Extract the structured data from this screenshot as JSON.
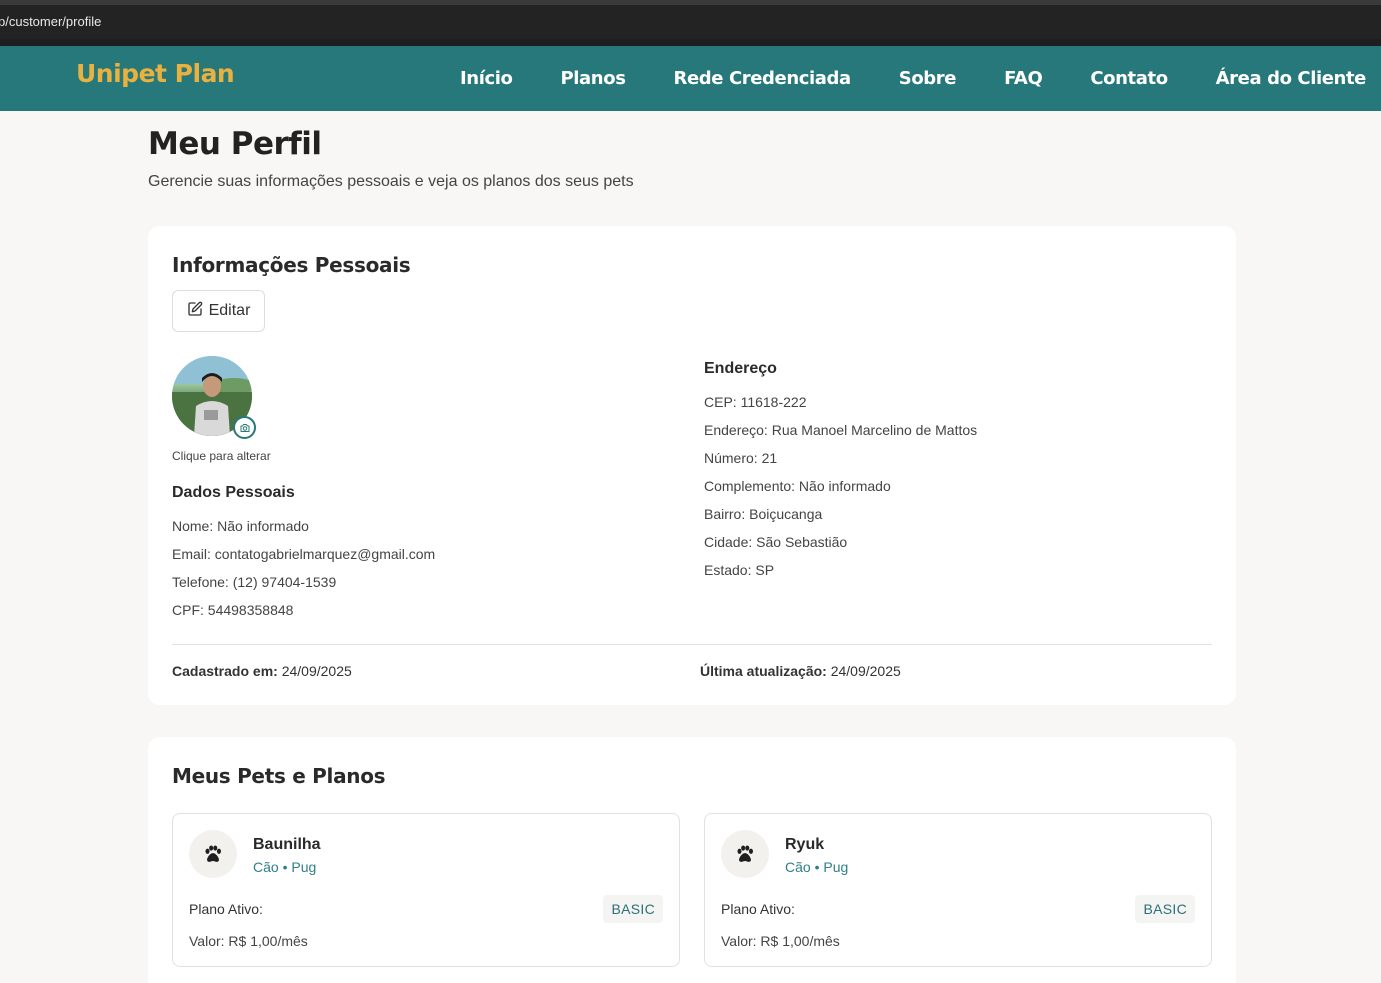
{
  "browser": {
    "url": "p/customer/profile"
  },
  "colors": {
    "brand": "#27787a",
    "logo": "#e9b13f",
    "accent_text": "#2d7f8a"
  },
  "nav": {
    "logo": "Unipet Plan",
    "links": [
      "Início",
      "Planos",
      "Rede Credenciada",
      "Sobre",
      "FAQ",
      "Contato",
      "Área do Cliente"
    ]
  },
  "page": {
    "title": "Meu Perfil",
    "subtitle": "Gerencie suas informações pessoais e veja os planos dos seus pets"
  },
  "personal": {
    "title": "Informações Pessoais",
    "edit_label": "Editar",
    "edit_icon": "edit-icon",
    "avatar_hint": "Clique para alterar",
    "dados_title": "Dados Pessoais",
    "fields": [
      "Nome: Não informado",
      "Email: contatogabrielmarquez@gmail.com",
      "Telefone: (12) 97404-1539",
      "CPF: 54498358848"
    ],
    "endereco_title": "Endereço",
    "address": [
      "CEP: 11618-222",
      "Endereço: Rua Manoel Marcelino de Mattos",
      "Número: 21",
      "Complemento: Não informado",
      "Bairro: Boiçucanga",
      "Cidade: São Sebastião",
      "Estado: SP"
    ],
    "created_label": "Cadastrado em:",
    "created_value": "24/09/2025",
    "updated_label": "Última atualização:",
    "updated_value": "24/09/2025"
  },
  "pets": {
    "title": "Meus Pets e Planos",
    "items": [
      {
        "name": "Baunilha",
        "species": "Cão • Pug",
        "plan_label": "Plano Ativo:",
        "plan": "BASIC",
        "price": "Valor: R$ 1,00/mês",
        "icon": "paw-icon"
      },
      {
        "name": "Ryuk",
        "species": "Cão • Pug",
        "plan_label": "Plano Ativo:",
        "plan": "BASIC",
        "price": "Valor: R$ 1,00/mês",
        "icon": "paw-icon"
      }
    ]
  }
}
